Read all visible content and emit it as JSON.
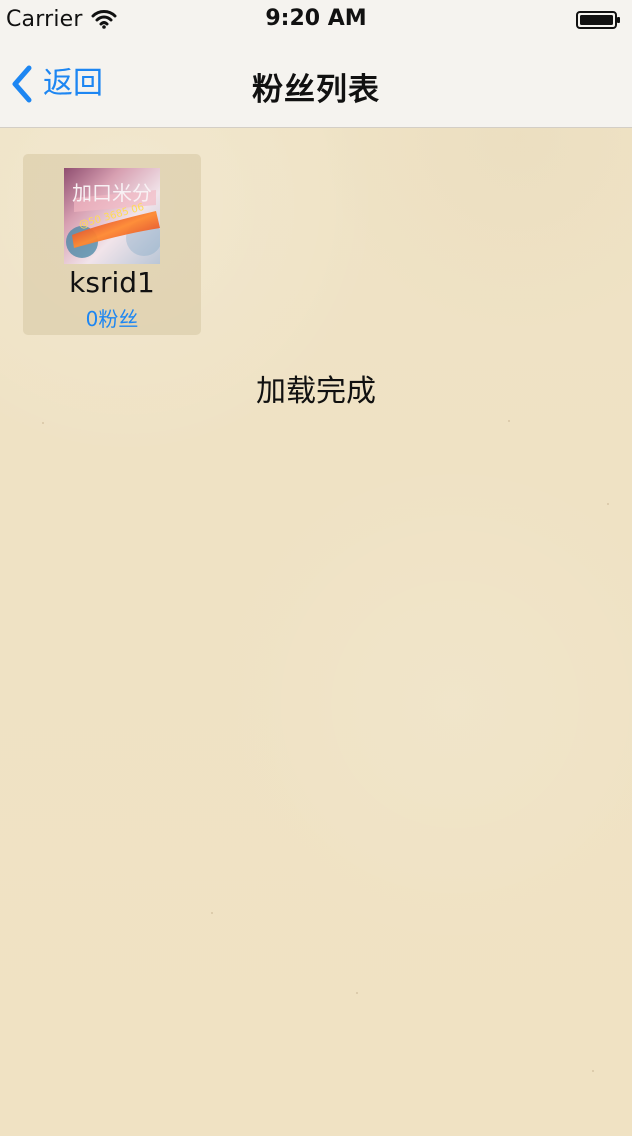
{
  "status_bar": {
    "carrier": "Carrier",
    "time": "9:20 AM",
    "wifi_icon": "wifi-icon",
    "battery_icon": "battery-icon"
  },
  "nav": {
    "back_label": "返回",
    "title": "粉丝列表",
    "back_icon": "chevron-left-icon",
    "accent_color": "#1d86f2"
  },
  "fans": [
    {
      "name": "ksrid1",
      "fan_count": "0粉丝",
      "avatar_text": "加口米分",
      "avatar_handle": "@50 3685 06"
    }
  ],
  "load_status": "加载完成"
}
